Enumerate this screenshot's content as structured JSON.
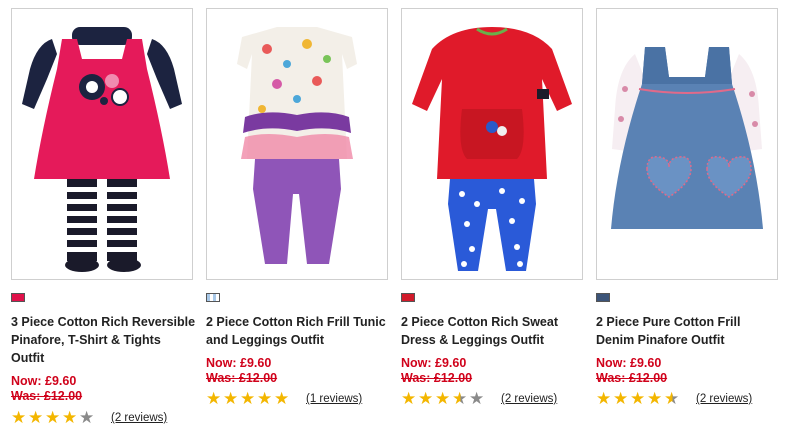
{
  "products": [
    {
      "swatch_color": "#e0114a",
      "name": "3 Piece Cotton Rich Reversible Pinafore, T-Shirt & Tights Outfit",
      "now": "Now: £9.60",
      "was": "Was: £12.00",
      "rating": 4,
      "reviews": "(2 reviews)"
    },
    {
      "swatch_color": "patterned",
      "name": "2 Piece Cotton Rich Frill Tunic and Leggings Outfit",
      "now": "Now: £9.60",
      "was": "Was: £12.00",
      "rating": 5,
      "reviews": "(1 reviews)"
    },
    {
      "swatch_color": "#d11a2a",
      "name": "2 Piece Cotton Rich Sweat Dress & Leggings Outfit",
      "now": "Now: £9.60",
      "was": "Was: £12.00",
      "rating": 3.5,
      "reviews": "(2 reviews)"
    },
    {
      "swatch_color": "#3c5478",
      "name": "2 Piece Pure Cotton Frill Denim Pinafore Outfit",
      "now": "Now: £9.60",
      "was": "Was: £12.00",
      "rating": 4.5,
      "reviews": "(2 reviews)"
    }
  ]
}
